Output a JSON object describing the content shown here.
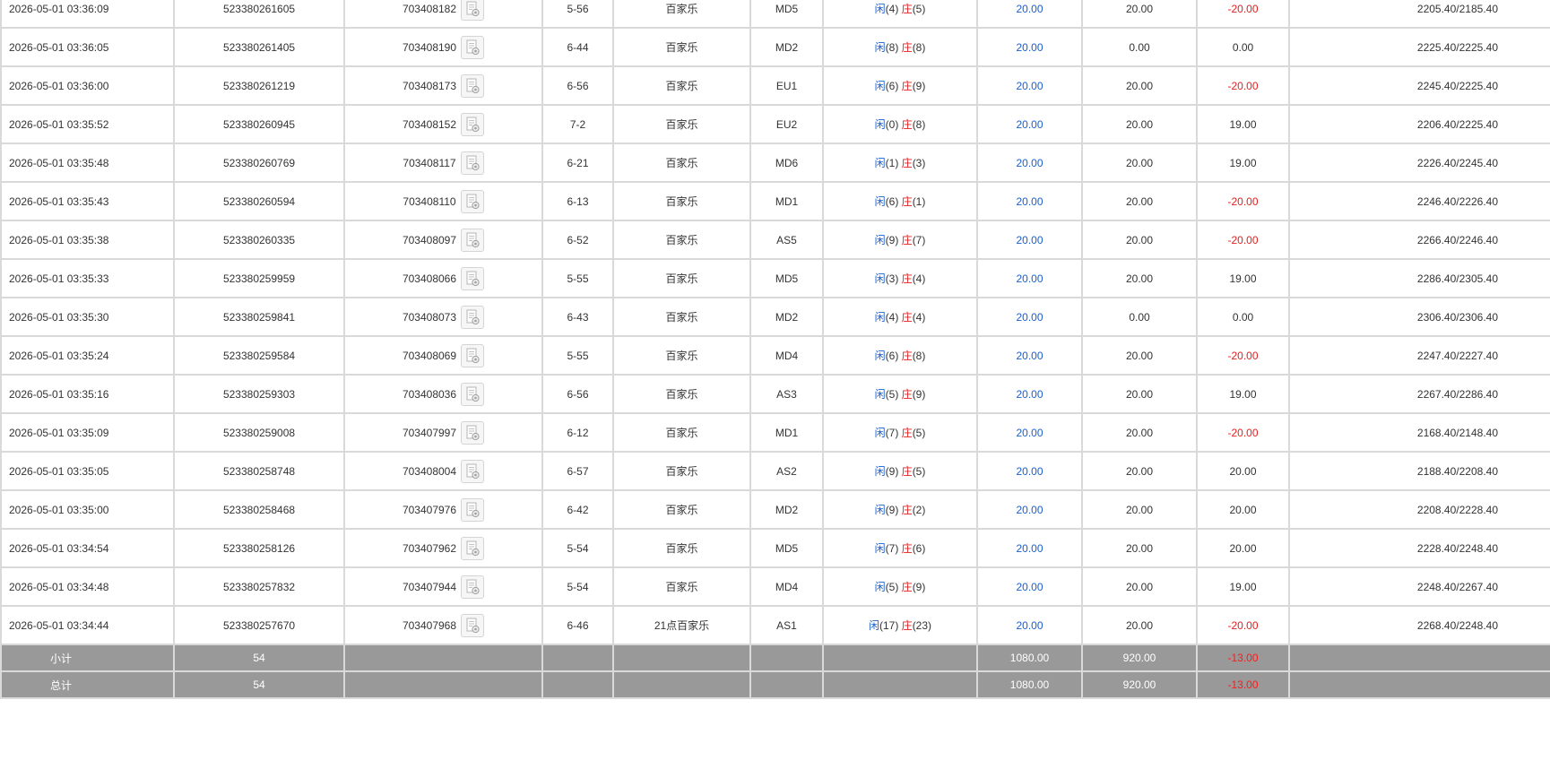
{
  "colors": {
    "accent_blue": "#1a5fcc",
    "loss_red": "#e02020",
    "summary_bg": "#999999",
    "border": "#d9d9d9"
  },
  "rows": [
    {
      "time": "2026-05-01 03:36:09",
      "order_no": "523380261605",
      "round_no": "703408182",
      "shoe": "5-56",
      "game": "百家乐",
      "table": "MD5",
      "player_label": "闲",
      "player_points": "(4)",
      "banker_label": "庄",
      "banker_points": "(5)",
      "bet": "20.00",
      "valid_bet": "20.00",
      "win_loss": "-20.00",
      "balance": "2205.40/2185.40"
    },
    {
      "time": "2026-05-01 03:36:05",
      "order_no": "523380261405",
      "round_no": "703408190",
      "shoe": "6-44",
      "game": "百家乐",
      "table": "MD2",
      "player_label": "闲",
      "player_points": "(8)",
      "banker_label": "庄",
      "banker_points": "(8)",
      "bet": "20.00",
      "valid_bet": "0.00",
      "win_loss": "0.00",
      "balance": "2225.40/2225.40"
    },
    {
      "time": "2026-05-01 03:36:00",
      "order_no": "523380261219",
      "round_no": "703408173",
      "shoe": "6-56",
      "game": "百家乐",
      "table": "EU1",
      "player_label": "闲",
      "player_points": "(6)",
      "banker_label": "庄",
      "banker_points": "(9)",
      "bet": "20.00",
      "valid_bet": "20.00",
      "win_loss": "-20.00",
      "balance": "2245.40/2225.40"
    },
    {
      "time": "2026-05-01 03:35:52",
      "order_no": "523380260945",
      "round_no": "703408152",
      "shoe": "7-2",
      "game": "百家乐",
      "table": "EU2",
      "player_label": "闲",
      "player_points": "(0)",
      "banker_label": "庄",
      "banker_points": "(8)",
      "bet": "20.00",
      "valid_bet": "20.00",
      "win_loss": "19.00",
      "balance": "2206.40/2225.40"
    },
    {
      "time": "2026-05-01 03:35:48",
      "order_no": "523380260769",
      "round_no": "703408117",
      "shoe": "6-21",
      "game": "百家乐",
      "table": "MD6",
      "player_label": "闲",
      "player_points": "(1)",
      "banker_label": "庄",
      "banker_points": "(3)",
      "bet": "20.00",
      "valid_bet": "20.00",
      "win_loss": "19.00",
      "balance": "2226.40/2245.40"
    },
    {
      "time": "2026-05-01 03:35:43",
      "order_no": "523380260594",
      "round_no": "703408110",
      "shoe": "6-13",
      "game": "百家乐",
      "table": "MD1",
      "player_label": "闲",
      "player_points": "(6)",
      "banker_label": "庄",
      "banker_points": "(1)",
      "bet": "20.00",
      "valid_bet": "20.00",
      "win_loss": "-20.00",
      "balance": "2246.40/2226.40"
    },
    {
      "time": "2026-05-01 03:35:38",
      "order_no": "523380260335",
      "round_no": "703408097",
      "shoe": "6-52",
      "game": "百家乐",
      "table": "AS5",
      "player_label": "闲",
      "player_points": "(9)",
      "banker_label": "庄",
      "banker_points": "(7)",
      "bet": "20.00",
      "valid_bet": "20.00",
      "win_loss": "-20.00",
      "balance": "2266.40/2246.40"
    },
    {
      "time": "2026-05-01 03:35:33",
      "order_no": "523380259959",
      "round_no": "703408066",
      "shoe": "5-55",
      "game": "百家乐",
      "table": "MD5",
      "player_label": "闲",
      "player_points": "(3)",
      "banker_label": "庄",
      "banker_points": "(4)",
      "bet": "20.00",
      "valid_bet": "20.00",
      "win_loss": "19.00",
      "balance": "2286.40/2305.40"
    },
    {
      "time": "2026-05-01 03:35:30",
      "order_no": "523380259841",
      "round_no": "703408073",
      "shoe": "6-43",
      "game": "百家乐",
      "table": "MD2",
      "player_label": "闲",
      "player_points": "(4)",
      "banker_label": "庄",
      "banker_points": "(4)",
      "bet": "20.00",
      "valid_bet": "0.00",
      "win_loss": "0.00",
      "balance": "2306.40/2306.40"
    },
    {
      "time": "2026-05-01 03:35:24",
      "order_no": "523380259584",
      "round_no": "703408069",
      "shoe": "5-55",
      "game": "百家乐",
      "table": "MD4",
      "player_label": "闲",
      "player_points": "(6)",
      "banker_label": "庄",
      "banker_points": "(8)",
      "bet": "20.00",
      "valid_bet": "20.00",
      "win_loss": "-20.00",
      "balance": "2247.40/2227.40"
    },
    {
      "time": "2026-05-01 03:35:16",
      "order_no": "523380259303",
      "round_no": "703408036",
      "shoe": "6-56",
      "game": "百家乐",
      "table": "AS3",
      "player_label": "闲",
      "player_points": "(5)",
      "banker_label": "庄",
      "banker_points": "(9)",
      "bet": "20.00",
      "valid_bet": "20.00",
      "win_loss": "19.00",
      "balance": "2267.40/2286.40"
    },
    {
      "time": "2026-05-01 03:35:09",
      "order_no": "523380259008",
      "round_no": "703407997",
      "shoe": "6-12",
      "game": "百家乐",
      "table": "MD1",
      "player_label": "闲",
      "player_points": "(7)",
      "banker_label": "庄",
      "banker_points": "(5)",
      "bet": "20.00",
      "valid_bet": "20.00",
      "win_loss": "-20.00",
      "balance": "2168.40/2148.40"
    },
    {
      "time": "2026-05-01 03:35:05",
      "order_no": "523380258748",
      "round_no": "703408004",
      "shoe": "6-57",
      "game": "百家乐",
      "table": "AS2",
      "player_label": "闲",
      "player_points": "(9)",
      "banker_label": "庄",
      "banker_points": "(5)",
      "bet": "20.00",
      "valid_bet": "20.00",
      "win_loss": "20.00",
      "balance": "2188.40/2208.40"
    },
    {
      "time": "2026-05-01 03:35:00",
      "order_no": "523380258468",
      "round_no": "703407976",
      "shoe": "6-42",
      "game": "百家乐",
      "table": "MD2",
      "player_label": "闲",
      "player_points": "(9)",
      "banker_label": "庄",
      "banker_points": "(2)",
      "bet": "20.00",
      "valid_bet": "20.00",
      "win_loss": "20.00",
      "balance": "2208.40/2228.40"
    },
    {
      "time": "2026-05-01 03:34:54",
      "order_no": "523380258126",
      "round_no": "703407962",
      "shoe": "5-54",
      "game": "百家乐",
      "table": "MD5",
      "player_label": "闲",
      "player_points": "(7)",
      "banker_label": "庄",
      "banker_points": "(6)",
      "bet": "20.00",
      "valid_bet": "20.00",
      "win_loss": "20.00",
      "balance": "2228.40/2248.40"
    },
    {
      "time": "2026-05-01 03:34:48",
      "order_no": "523380257832",
      "round_no": "703407944",
      "shoe": "5-54",
      "game": "百家乐",
      "table": "MD4",
      "player_label": "闲",
      "player_points": "(5)",
      "banker_label": "庄",
      "banker_points": "(9)",
      "bet": "20.00",
      "valid_bet": "20.00",
      "win_loss": "19.00",
      "balance": "2248.40/2267.40"
    },
    {
      "time": "2026-05-01 03:34:44",
      "order_no": "523380257670",
      "round_no": "703407968",
      "shoe": "6-46",
      "game": "21点百家乐",
      "table": "AS1",
      "player_label": "闲",
      "player_points": "(17)",
      "banker_label": "庄",
      "banker_points": "(23)",
      "bet": "20.00",
      "valid_bet": "20.00",
      "win_loss": "-20.00",
      "balance": "2268.40/2248.40"
    }
  ],
  "summary": [
    {
      "label": "小计",
      "count": "54",
      "bet": "1080.00",
      "valid_bet": "920.00",
      "win_loss": "-13.00"
    },
    {
      "label": "总计",
      "count": "54",
      "bet": "1080.00",
      "valid_bet": "920.00",
      "win_loss": "-13.00"
    }
  ]
}
